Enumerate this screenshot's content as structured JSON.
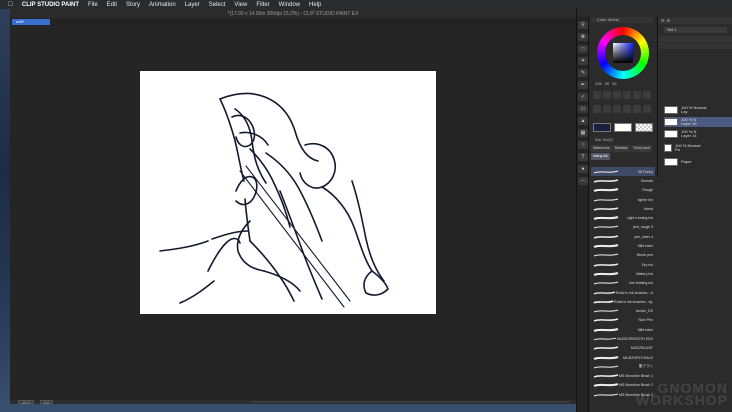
{
  "menubar": {
    "app_name": "CLIP STUDIO PAINT",
    "items": [
      "File",
      "Edit",
      "Story",
      "Animation",
      "Layer",
      "Select",
      "View",
      "Filter",
      "Window",
      "Help"
    ]
  },
  "window": {
    "title": "*(17.00 x 14.00in 300dpi 15.2%) - CLIP STUDIO PAINT EX",
    "doc_tab": "unti*"
  },
  "statusbar": {
    "zoom": "15.2",
    "angle": "0.0"
  },
  "color_panel": {
    "tab_label": "Color Wheel",
    "h": "235",
    "s": "99",
    "v": "26"
  },
  "layer_panel": {
    "set_label": "Set 1",
    "layers": [
      {
        "opacity": "100 % Normal",
        "name": "Lay"
      },
      {
        "opacity": "100 % N",
        "name": "Layer 16"
      },
      {
        "opacity": "100 % N",
        "name": "Layer 14"
      },
      {
        "opacity": "100 % Normal",
        "name": "Pa"
      },
      {
        "opacity": "",
        "name": "Paper"
      }
    ]
  },
  "subtool_panel": {
    "header": "Sub Tool [G",
    "groups": [
      "Watercolor",
      "Realistic",
      "Thick paint",
      "Inking ink"
    ],
    "brushes": [
      "3D Funky",
      "Smooth",
      "Rough",
      "lighter ink",
      "bleed",
      "Light running ink",
      "pen_rough 3",
      "pen_inker 4",
      "Mild inker",
      "Brush pen",
      "Dry ink",
      "Watery ink",
      "line blotting ink",
      "Rubin's Ink brushes - by C",
      "Rubin's Ink brushes - by Drcor",
      "kenkin_DS",
      "Nice Pen",
      "Mild inker",
      "MUDZORKSOTH EDGE",
      "MUDZBLUNT",
      "MUDZDRYCHALK",
      "筆ブラシ",
      "MS Monoline Brush 1",
      "MS Monoline Brush 2",
      "MS Monoline Brush 3"
    ]
  },
  "colors": {
    "accent": "#3a6fd0",
    "main_color": "#1a2040",
    "sub_color": "#ffffff"
  }
}
